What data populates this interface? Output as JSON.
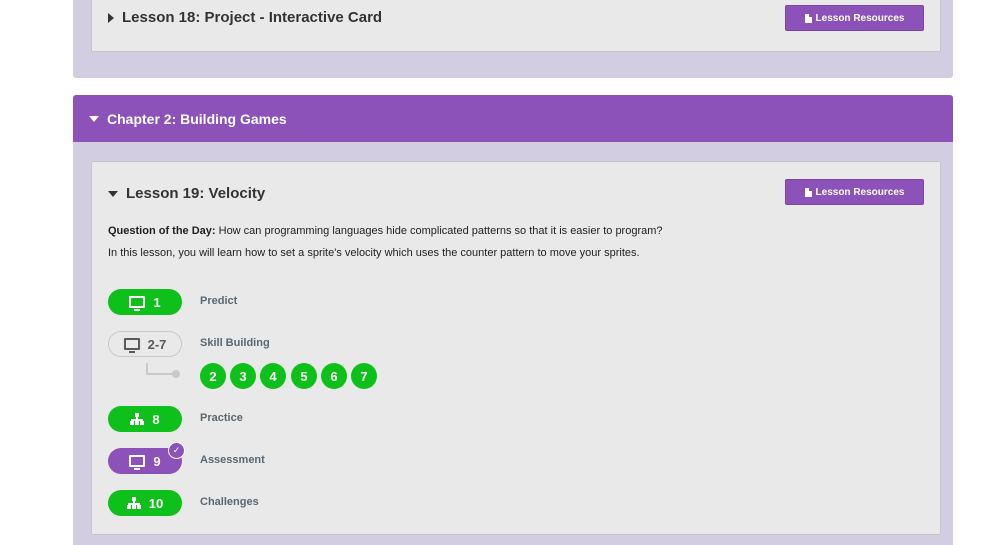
{
  "chapter1": {
    "lesson": {
      "title": "Lesson 18: Project - Interactive Card",
      "resources_label": "Lesson Resources"
    }
  },
  "chapter2": {
    "title": "Chapter 2: Building Games",
    "lesson": {
      "title": "Lesson 19: Velocity",
      "resources_label": "Lesson Resources",
      "question_label": "Question of the Day:",
      "question_text": " How can programming languages hide complicated patterns so that it is easier to program?",
      "description": "In this lesson, you will learn how to set a sprite's velocity which uses the counter pattern to move your sprites.",
      "levels": [
        {
          "number": "1",
          "label": "Predict",
          "icon": "monitor-icon",
          "status": "completed"
        },
        {
          "number": "2-7",
          "label": "Skill Building",
          "icon": "monitor-icon",
          "status": "not-started"
        },
        {
          "number": "8",
          "label": "Practice",
          "icon": "sitemap-icon",
          "status": "completed"
        },
        {
          "number": "9",
          "label": "Assessment",
          "icon": "monitor-icon",
          "status": "submitted"
        },
        {
          "number": "10",
          "label": "Challenges",
          "icon": "sitemap-icon",
          "status": "completed"
        }
      ],
      "sublevels": [
        "2",
        "3",
        "4",
        "5",
        "6",
        "7"
      ]
    }
  },
  "colors": {
    "accent_purple": "#8c52ba",
    "completed_green": "#0dc11a",
    "chapter_bg": "#d3cde1",
    "card_bg": "#e9e9ea"
  }
}
